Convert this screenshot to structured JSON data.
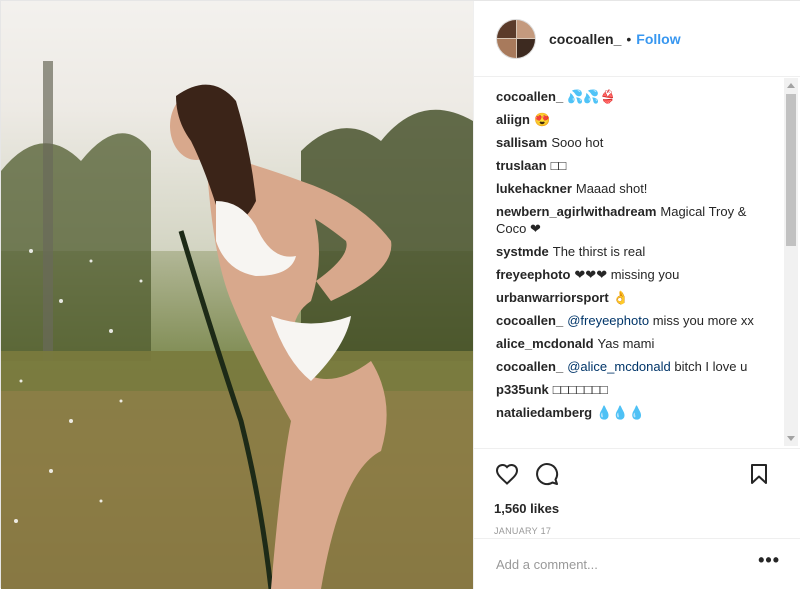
{
  "post": {
    "photo_alt": "",
    "header": {
      "username": "cocoallen_",
      "separator": "•",
      "follow_label": "Follow"
    },
    "comments": [
      {
        "user": "cocoallen_",
        "text": "💦💦👙"
      },
      {
        "user": "aliign",
        "text": "😍"
      },
      {
        "user": "sallisam",
        "text": "Sooo hot"
      },
      {
        "user": "truslaan",
        "text": "□□"
      },
      {
        "user": "lukehackner",
        "text": "Maaad shot!"
      },
      {
        "user": "newbern_agirlwithadream",
        "text": "Magical Troy & Coco ❤"
      },
      {
        "user": "systmde",
        "text": "The thirst is real"
      },
      {
        "user": "freyeephoto",
        "text": "❤❤❤ missing you"
      },
      {
        "user": "urbanwarriorsport",
        "text": "👌"
      },
      {
        "user": "cocoallen_",
        "mention": "@freyeephoto",
        "text": "miss you more xx"
      },
      {
        "user": "alice_mcdonald",
        "text": "Yas mami"
      },
      {
        "user": "cocoallen_",
        "mention": "@alice_mcdonald",
        "text": "bitch I love u"
      },
      {
        "user": "p335unk",
        "text": "□□□□□□□"
      },
      {
        "user": "nataliedamberg",
        "text": "💧💧💧"
      }
    ],
    "likes": "1,560 likes",
    "date": "JANUARY 17",
    "add_comment_placeholder": "Add a comment...",
    "more_label": "•••",
    "icons": {
      "like": "heart-icon",
      "comment": "comment-bubble-icon",
      "save": "bookmark-icon"
    }
  }
}
